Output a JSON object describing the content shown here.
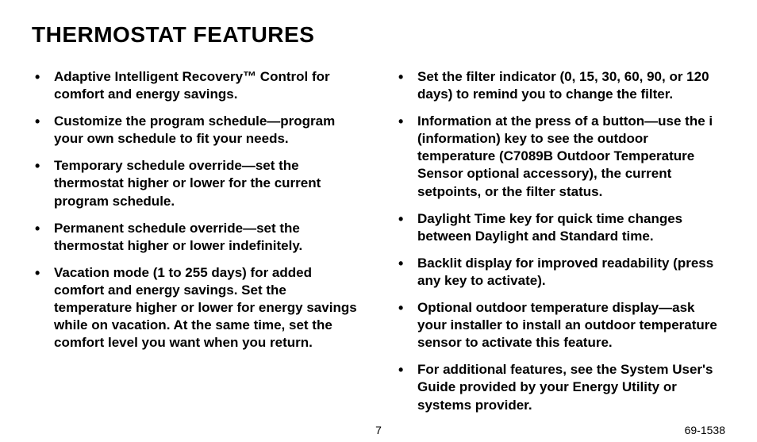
{
  "title": "THERMOSTAT FEATURES",
  "left_items": [
    "Adaptive Intelligent Recovery™ Control for comfort and energy savings.",
    "Customize the program schedule—program your own schedule to fit your needs.",
    "Temporary schedule override—set the thermostat higher or lower for the current program schedule.",
    "Permanent schedule override—set the thermostat higher or lower indefinitely.",
    "Vacation mode (1 to 255 days) for added comfort and energy savings. Set the temperature higher or lower for energy savings while on vacation. At the same time, set the comfort level you want when you return."
  ],
  "right_items": [
    "Set the filter indicator (0, 15, 30, 60, 90, or 120 days) to remind you to change the filter.",
    "Information at the press of a button—use the i (information) key to see the outdoor temperature (C7089B Outdoor Temperature Sensor optional accessory), the current setpoints, or the filter status.",
    "Daylight Time key for quick time changes between Daylight and Standard time.",
    "Backlit display for improved readability (press any key to activate).",
    "Optional outdoor temperature display—ask your installer to install an outdoor temperature sensor to activate this feature.",
    "For additional features, see the System User's Guide provided by your Energy Utility or systems provider."
  ],
  "page_number": "7",
  "doc_number": "69-1538"
}
